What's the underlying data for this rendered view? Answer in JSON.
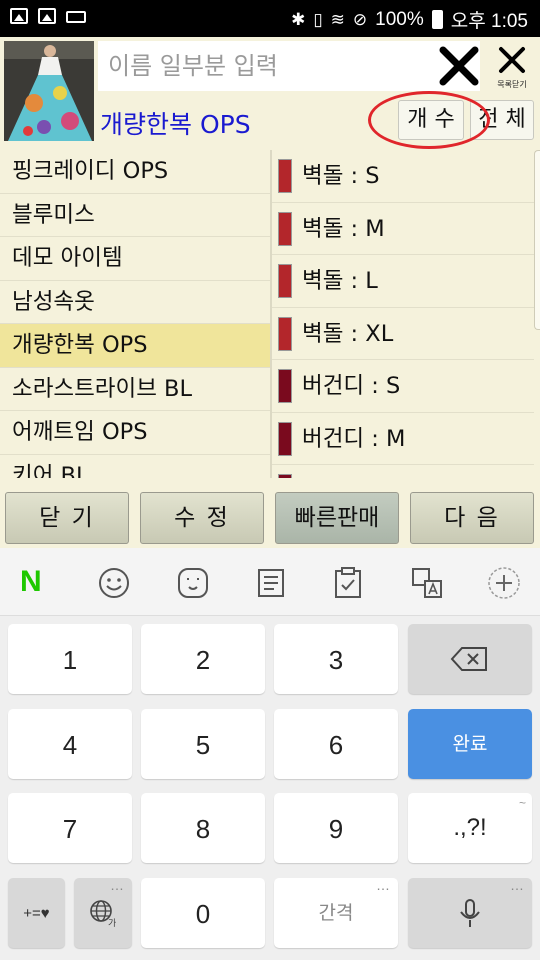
{
  "status_bar": {
    "battery": "100%",
    "time": "오후 1:05"
  },
  "header": {
    "search_placeholder": "이름 일부분 입력",
    "close_list_label": "목록닫기",
    "page_title": "개량한복 OPS",
    "count_button": "개 수",
    "all_button": "전 체"
  },
  "categories": [
    {
      "label": "핑크레이디 OPS",
      "selected": false
    },
    {
      "label": "블루미스",
      "selected": false
    },
    {
      "label": "데모 아이템",
      "selected": false
    },
    {
      "label": "남성속옷",
      "selected": false
    },
    {
      "label": "개량한복 OPS",
      "selected": true
    },
    {
      "label": "소라스트라이브 BL",
      "selected": false
    },
    {
      "label": "어깨트임 OPS",
      "selected": false
    },
    {
      "label": "키어 BL",
      "selected": false
    }
  ],
  "options": [
    {
      "label": "벽돌 : S",
      "color": "#b3262b"
    },
    {
      "label": "벽돌 : M",
      "color": "#b3262b"
    },
    {
      "label": "벽돌 : L",
      "color": "#b3262b"
    },
    {
      "label": "벽돌 : XL",
      "color": "#b3262b"
    },
    {
      "label": "버건디 : S",
      "color": "#7a0a1e"
    },
    {
      "label": "버건디 : M",
      "color": "#7a0a1e"
    },
    {
      "label": "",
      "color": "#7a0a1e"
    }
  ],
  "actions": {
    "close": "닫 기",
    "edit": "수 정",
    "quick_sale": "빠른판매",
    "next": "다 음"
  },
  "keyboard": {
    "keys": [
      "1",
      "2",
      "3",
      "4",
      "5",
      "6",
      "7",
      "8",
      "9",
      "0"
    ],
    "done": "완료",
    "punct": ".,?!",
    "space": "간격",
    "symbols": "+=♥",
    "naver": "N"
  },
  "colors": {
    "accent_blue": "#1a1ad0",
    "selected_row": "#f0e59b",
    "annotation_red": "#e0262b",
    "done_key": "#4a90e2"
  }
}
